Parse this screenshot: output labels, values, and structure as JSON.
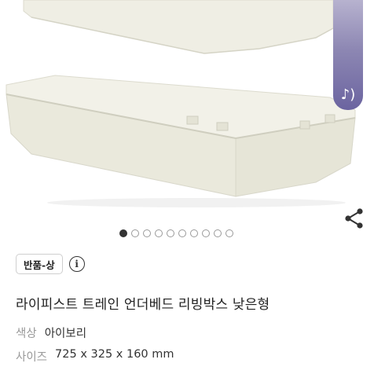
{
  "product": {
    "condition_badge": "반품-상",
    "info_icon": "info-icon",
    "title": "라이피스트 트레인 언더베드 리빙박스 낮은형",
    "specs": [
      {
        "label": "색상",
        "value": "아이보리"
      },
      {
        "label": "사이즈",
        "value": "725 x 325 x 160 mm"
      }
    ]
  },
  "gallery": {
    "image": "ivory-storage-box-photo",
    "total_slides": 10,
    "active_index": 0,
    "share_icon": "share-icon",
    "audio_icon": "music-note-icon",
    "colors": {
      "box_ivory": "#efeee4",
      "box_shadow": "#e0dfd3",
      "audio_tab": "#6b64a0"
    }
  }
}
